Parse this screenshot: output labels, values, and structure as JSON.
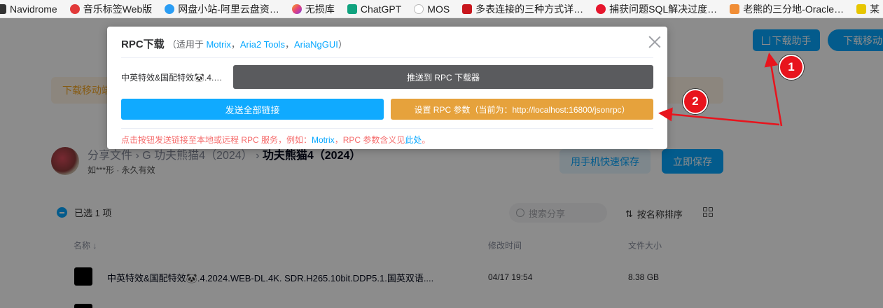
{
  "bookmarks": [
    {
      "label": "Navidrome",
      "icon": "navidrome-icon",
      "color": "#333333"
    },
    {
      "label": "音乐标签Web版",
      "icon": "music-tag-icon",
      "color": "#e23a3a"
    },
    {
      "label": "网盘小站-阿里云盘资…",
      "icon": "cloud-icon",
      "color": "#2a9df4"
    },
    {
      "label": "无损库",
      "icon": "lossless-icon",
      "color": "#e6427a"
    },
    {
      "label": "ChatGPT",
      "icon": "chatgpt-icon",
      "color": "#10a37f"
    },
    {
      "label": "MOS",
      "icon": "mos-icon",
      "color": "#bbbbbb"
    },
    {
      "label": "多表连接的三种方式详…",
      "icon": "csdn-icon",
      "color": "#c8161d"
    },
    {
      "label": "捕获问题SQL解决过度…",
      "icon": "weibo-icon",
      "color": "#e6162d"
    },
    {
      "label": "老熊的三分地-Oracle…",
      "icon": "blog-icon",
      "color": "#f08d35"
    },
    {
      "label": "某",
      "icon": "bookmark-icon",
      "color": "#e7c600"
    }
  ],
  "header": {
    "helper_button": "下载助手",
    "download_button": "下载移动"
  },
  "notice": {
    "text": "下载移动端"
  },
  "breadcrumb": {
    "root": "分享文件",
    "sep": "›",
    "parent": "G 功夫熊猫4（2024）",
    "current": "功夫熊猫4（2024）"
  },
  "sharer": {
    "text": "如***形 · 永久有效"
  },
  "actions": {
    "phone_save": "用手机快速保存",
    "save_now": "立即保存"
  },
  "toolbar": {
    "selected": "已选 1 项",
    "search_placeholder": "搜索分享",
    "sort": "按名称排序"
  },
  "table": {
    "headers": {
      "name": "名称",
      "time": "修改时间",
      "size": "文件大小"
    },
    "rows": [
      {
        "name": "中英特效&国配特效🐼.4.2024.WEB-DL.4K. SDR.H265.10bit.DDP5.1.国英双语....",
        "time": "04/17 19:54",
        "size": "8.38 GB"
      }
    ]
  },
  "dialog": {
    "title": "RPC下载",
    "subtitle_prefix": "（适用于 ",
    "tools": [
      "Motrix",
      "Aria2 Tools",
      "AriaNgGUI"
    ],
    "tool_sep": "，",
    "subtitle_suffix": "）",
    "file_name": "中英特效&国配特效🐼.4.2024.WEB-DL.4K",
    "push_button": "推送到 RPC 下载器",
    "send_all_button": "发送全部链接",
    "settings_button": "设置 RPC 参数（当前为：http://localhost:16800/jsonrpc）",
    "hint_prefix": "点击按钮发送链接至本地或远程 RPC 服务，例如：",
    "hint_example": "Motrix",
    "hint_middle": "，RPC 参数含义见",
    "hint_link": "此处",
    "hint_suffix": "。"
  },
  "annotations": [
    {
      "label": "1",
      "color": "#e8141d"
    },
    {
      "label": "2",
      "color": "#e8141d"
    }
  ]
}
